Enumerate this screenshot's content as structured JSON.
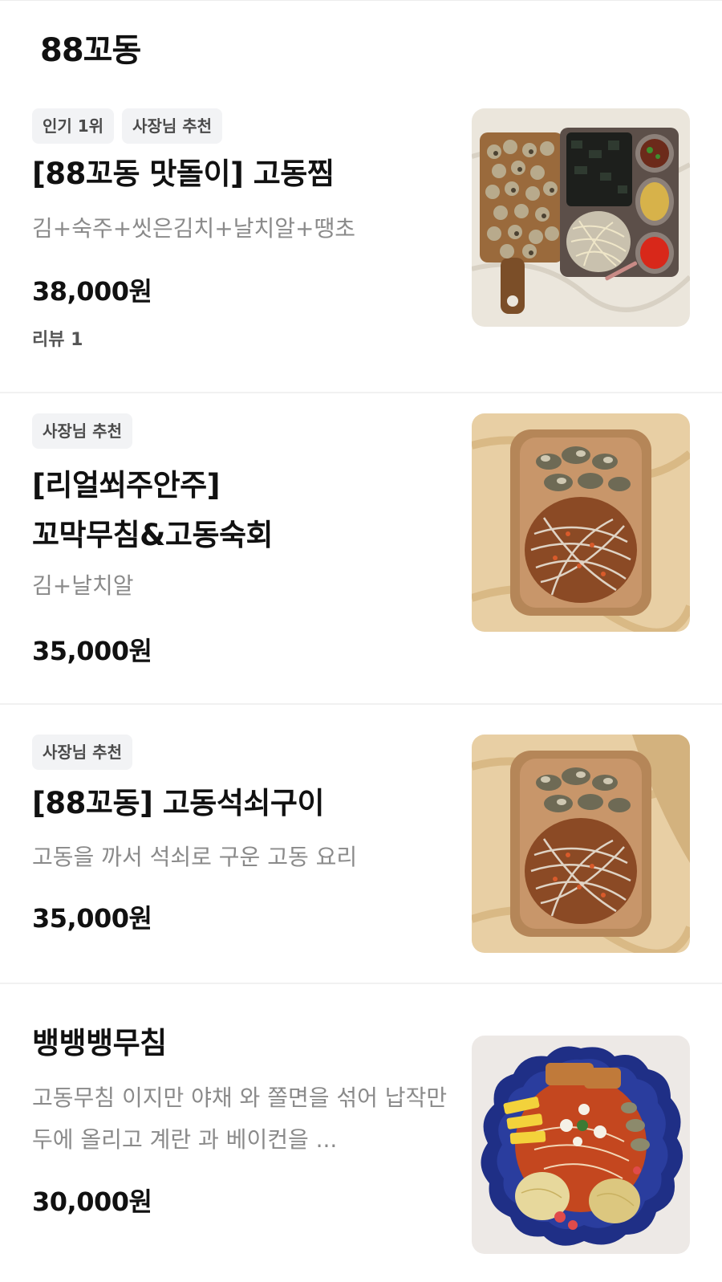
{
  "section_title": "88꼬동",
  "items": [
    {
      "badges": [
        "인기 1위",
        "사장님 추천"
      ],
      "name": "[88꼬동 맛돌이] 고동찜",
      "description": "김+숙주+씻은김치+날치알+땡초",
      "price": "38,000원",
      "review_label": "리뷰",
      "review_count": "1",
      "photo": "steamed-sea-snail-platter"
    },
    {
      "badges": [
        "사장님 추천"
      ],
      "name": "[리얼쐬주안주]\n꼬막무침&고동숙회",
      "description": "김+날치알",
      "price": "35,000원",
      "photo": "cockle-salad-wooden-tray"
    },
    {
      "badges": [
        "사장님 추천"
      ],
      "name": "[88꼬동] 고동석쇠구이",
      "description": "고동을 까서 석쇠로 구운 고동 요리",
      "price": "35,000원",
      "photo": "grilled-sea-snail-tray"
    },
    {
      "badges": [],
      "name": "뱅뱅뱅무침",
      "description": "고동무침 이지만 야채 와 쫄면을 섞어 납작만두에 올리고 계란 과 베이컨을 ...",
      "price": "30,000원",
      "photo": "spicy-salad-blue-bowl"
    }
  ]
}
